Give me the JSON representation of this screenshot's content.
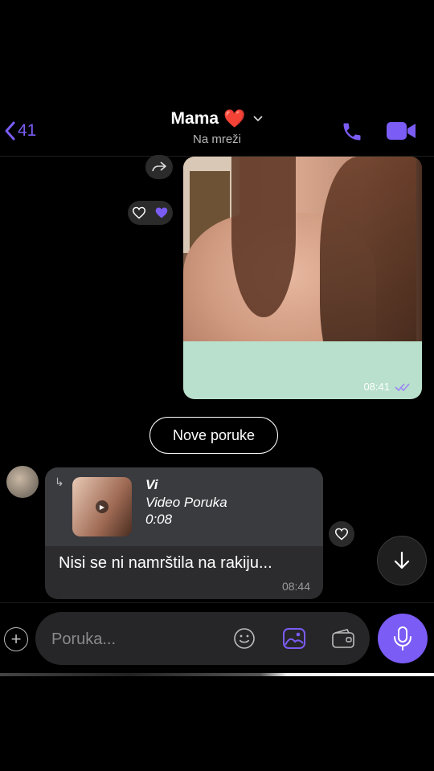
{
  "header": {
    "back_count": "41",
    "contact_name": "Mama",
    "contact_emoji": "❤️",
    "status": "Na mreži",
    "accent_color": "#7b5cf5"
  },
  "sent_photo": {
    "time": "08:41",
    "read_icon": "double-check-icon"
  },
  "separator": {
    "label": "Nove poruke"
  },
  "received_message": {
    "quote_author": "Vi",
    "quote_type": "Video Poruka",
    "quote_duration": "0:08",
    "text": "Nisi se ni namrštila na rakiju...",
    "time": "08:44"
  },
  "composer": {
    "placeholder": "Poruka..."
  }
}
